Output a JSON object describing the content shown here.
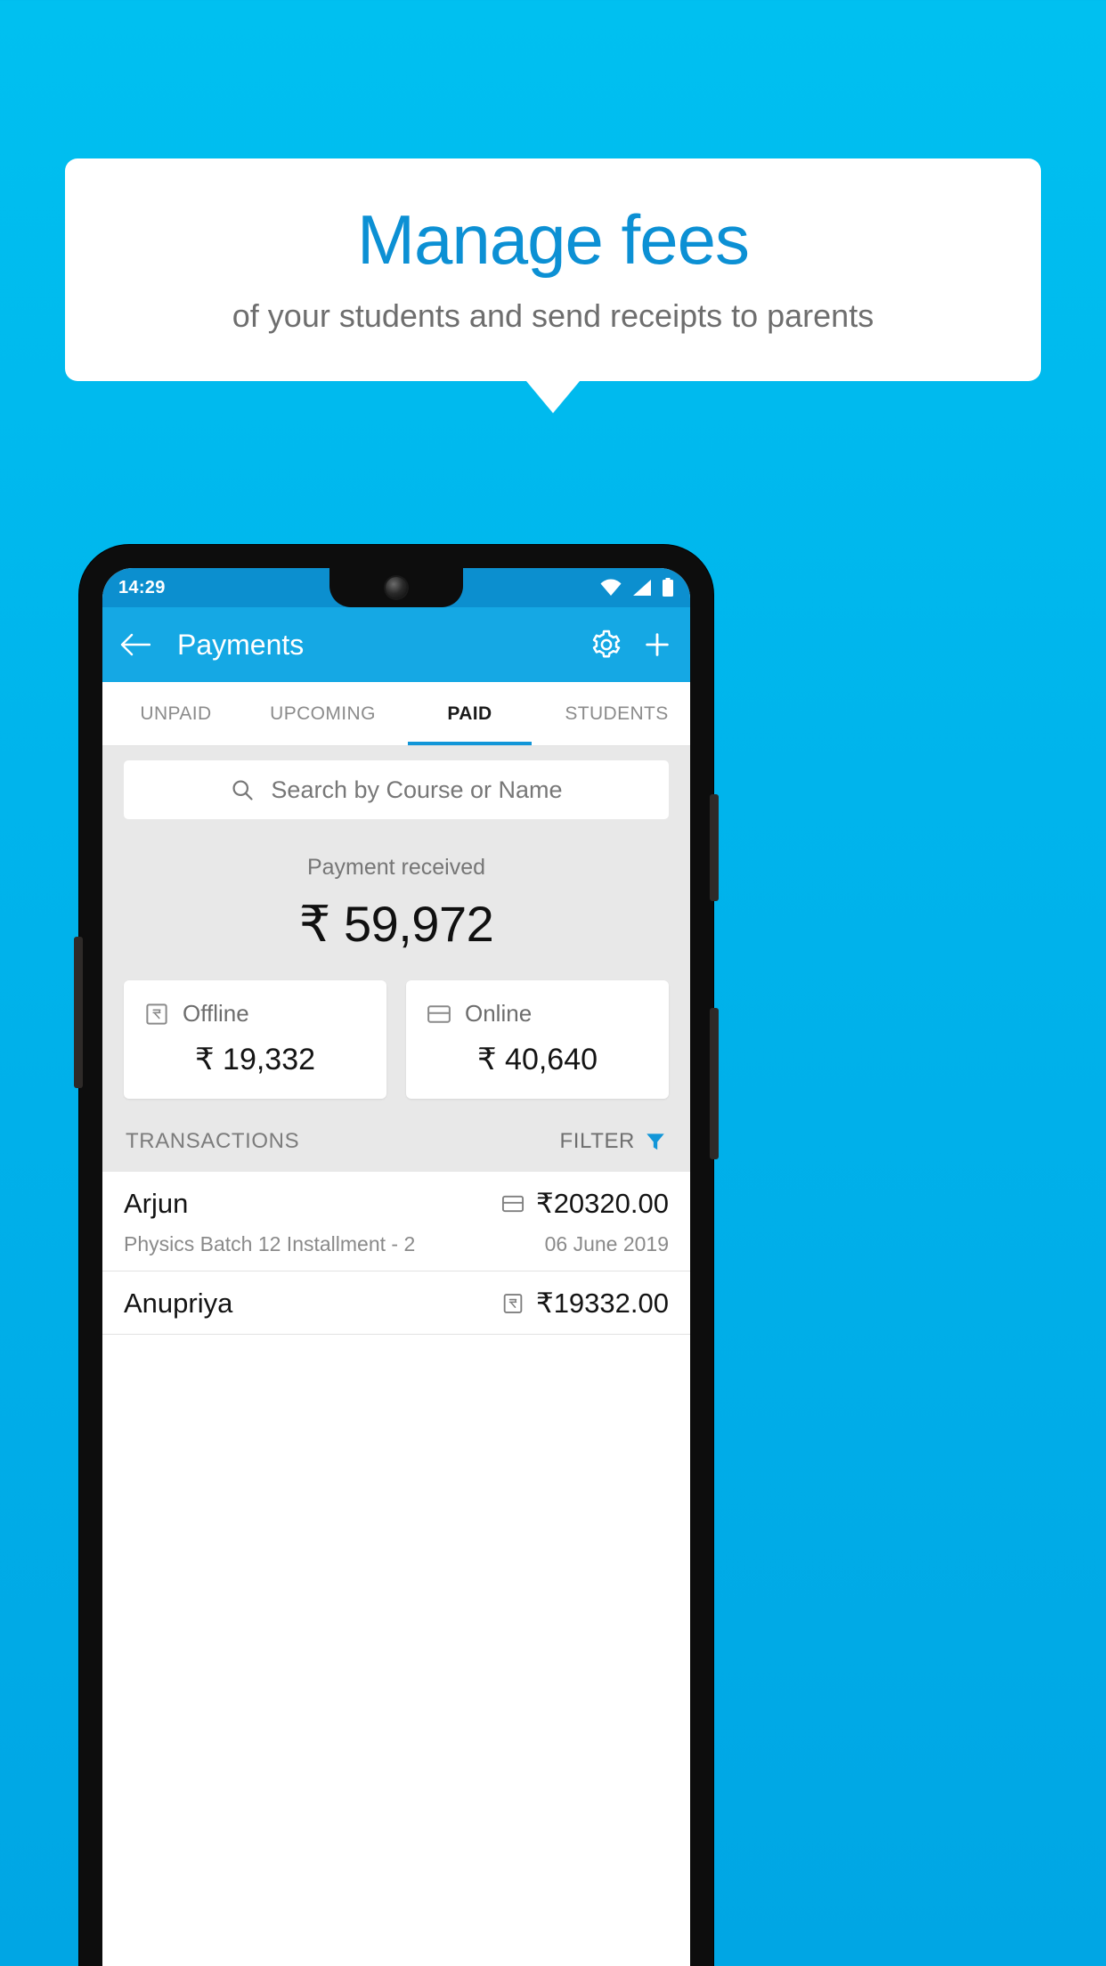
{
  "promo": {
    "title": "Manage fees",
    "subtitle": "of your students and send receipts to parents",
    "title_color": "#0C90D4",
    "background_color": "#ffffff"
  },
  "theme": {
    "page_gradient_top": "#00C0F0",
    "page_gradient_bottom": "#00A6E4",
    "appbar_color": "#15A8E4",
    "statusbar_color": "#0C8FCF",
    "accent": "#1296D8"
  },
  "phone": {
    "statusbar": {
      "time": "14:29",
      "icons": [
        "wifi-icon",
        "signal-icon",
        "battery-icon"
      ]
    },
    "appbar": {
      "back_icon": "back-arrow-icon",
      "title": "Payments",
      "settings_icon": "gear-icon",
      "add_icon": "plus-icon"
    },
    "tabs": [
      {
        "label": "UNPAID",
        "active": false
      },
      {
        "label": "UPCOMING",
        "active": false
      },
      {
        "label": "PAID",
        "active": true
      },
      {
        "label": "STUDENTS",
        "active": false
      }
    ],
    "search": {
      "icon": "search-icon",
      "placeholder": "Search by Course or Name",
      "value": ""
    },
    "summary": {
      "label": "Payment received",
      "amount": "₹ 59,972"
    },
    "payment_modes": [
      {
        "icon": "cash-note-icon",
        "label": "Offline",
        "amount": "₹ 19,332"
      },
      {
        "icon": "credit-card-icon",
        "label": "Online",
        "amount": "₹ 40,640"
      }
    ],
    "transactions_bar": {
      "title": "TRANSACTIONS",
      "filter_label": "FILTER",
      "filter_icon": "funnel-icon",
      "filter_icon_color": "#1296D8"
    },
    "transactions": [
      {
        "name": "Arjun",
        "mode_icon": "credit-card-icon",
        "amount": "₹20320.00",
        "description": "Physics Batch 12 Installment - 2",
        "date": "06 June 2019"
      },
      {
        "name": "Anupriya",
        "mode_icon": "cash-note-icon",
        "amount": "₹19332.00",
        "description": "",
        "date": ""
      }
    ]
  }
}
